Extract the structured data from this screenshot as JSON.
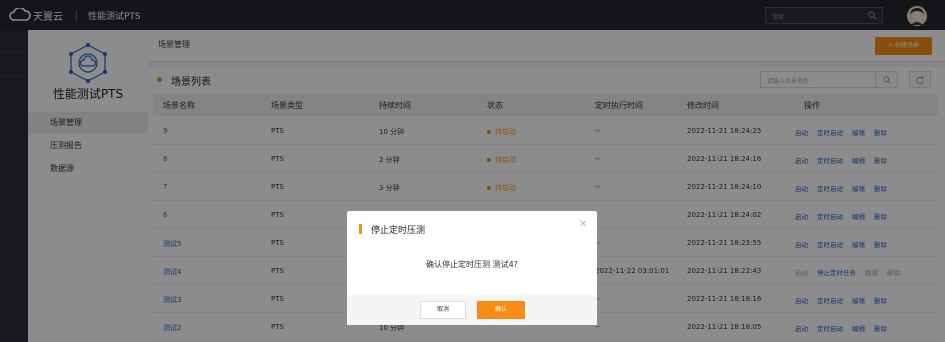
{
  "topbar": {
    "logo_text": "天翼云",
    "product": "性能测试PTS",
    "search_placeholder": "搜索"
  },
  "sidebar": {
    "title": "性能测试PTS",
    "items": [
      {
        "label": "场景管理"
      },
      {
        "label": "压测报告"
      },
      {
        "label": "数据源"
      }
    ]
  },
  "header": {
    "title": "场景管理",
    "create_label": "+ 创建场景"
  },
  "list": {
    "title": "场景列表",
    "search_placeholder": "请输入场景名称",
    "columns": [
      "场景名称",
      "场景类型",
      "持续时间",
      "状态",
      "定时执行时间",
      "修改时间",
      "操作"
    ],
    "rows": [
      {
        "name": "9",
        "type": "PTS",
        "duration": "10 分钟",
        "status": "待启动",
        "schedule": "--",
        "modified": "2022-11-21 18:24:25",
        "ops": [
          "启动",
          "定时启动",
          "编辑",
          "删除"
        ]
      },
      {
        "name": "8",
        "type": "PTS",
        "duration": "2 分钟",
        "status": "待启动",
        "schedule": "--",
        "modified": "2022-11-21 18:24:16",
        "ops": [
          "启动",
          "定时启动",
          "编辑",
          "删除"
        ]
      },
      {
        "name": "7",
        "type": "PTS",
        "duration": "3 分钟",
        "status": "待启动",
        "schedule": "--",
        "modified": "2022-11-21 18:24:10",
        "ops": [
          "启动",
          "定时启动",
          "编辑",
          "删除"
        ]
      },
      {
        "name": "6",
        "type": "PTS",
        "duration": "",
        "status": "",
        "schedule": "",
        "modified": "2022-11-21 18:24:02",
        "ops": [
          "启动",
          "定时启动",
          "编辑",
          "删除"
        ]
      },
      {
        "name": "测试5",
        "type": "PTS",
        "duration": "",
        "status": "",
        "schedule": "--",
        "modified": "2022-11-21 18:23:55",
        "ops": [
          "启动",
          "定时启动",
          "编辑",
          "删除"
        ]
      },
      {
        "name": "测试4",
        "type": "PTS",
        "duration": "",
        "status": "",
        "schedule": "2022-11-22 03:01:01",
        "modified": "2022-11-21 18:22:43",
        "ops": [
          "启动",
          "停止定时任务",
          "编辑",
          "删除"
        ]
      },
      {
        "name": "测试3",
        "type": "PTS",
        "duration": "",
        "status": "",
        "schedule": "--",
        "modified": "2022-11-21 18:18:16",
        "ops": [
          "启动",
          "定时启动",
          "编辑",
          "删除"
        ]
      },
      {
        "name": "测试2",
        "type": "PTS",
        "duration": "10 分钟",
        "status": "",
        "schedule": "--",
        "modified": "2022-11-21 18:18:05",
        "ops": [
          "启动",
          "定时启动",
          "编辑",
          "删除"
        ]
      }
    ]
  },
  "modal": {
    "title": "停止定时压测",
    "message": "确认停止定时压测 测试4?",
    "cancel": "取消",
    "confirm": "确认"
  }
}
